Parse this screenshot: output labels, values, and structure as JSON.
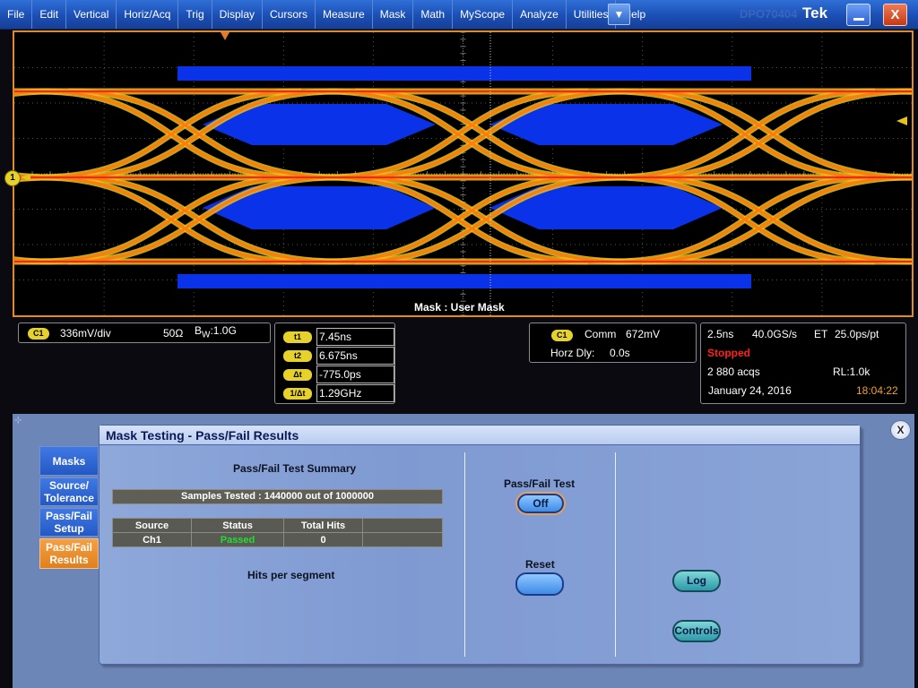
{
  "menubar": {
    "items": [
      "File",
      "Edit",
      "Vertical",
      "Horiz/Acq",
      "Trig",
      "Display",
      "Cursors",
      "Measure",
      "Mask",
      "Math",
      "MyScope",
      "Analyze",
      "Utilities",
      "Help"
    ],
    "dropdown_glyph": "▼",
    "ghost_text": "DPO70404",
    "logo": "Tek",
    "close_glyph": "X"
  },
  "display": {
    "mask_label": "Mask : User Mask",
    "channel_marker": "1"
  },
  "channel_readout": {
    "badge": "C1",
    "scale": "336mV/div",
    "impedance": "50Ω",
    "bandwidth_prefix": "B",
    "bandwidth_sub": "W",
    "bandwidth_value": ":1.0G"
  },
  "cursors": [
    {
      "badge": "t1",
      "value": "7.45ns"
    },
    {
      "badge": "t2",
      "value": "6.675ns"
    },
    {
      "badge": "Δt",
      "value": "-775.0ps"
    },
    {
      "badge": "1/Δt",
      "value": "1.29GHz"
    }
  ],
  "trigger_readout": {
    "badge": "C1",
    "mode": "Comm",
    "level": "672mV",
    "horz_dly_label": "Horz Dly:",
    "horz_dly_value": "0.0s"
  },
  "acq_readout": {
    "timebase": "2.5ns",
    "sample_rate": "40.0GS/s",
    "mode": "ET",
    "resolution": "25.0ps/pt",
    "status": "Stopped",
    "acqs": "2 880 acqs",
    "record_length": "RL:1.0k",
    "date": "January 24, 2016",
    "time": "18:04:22"
  },
  "panel": {
    "close_glyph": "X",
    "title": "Mask Testing - Pass/Fail Results",
    "tabs": [
      {
        "label": "Masks",
        "active": false
      },
      {
        "label": "Source/ Tolerance",
        "active": false
      },
      {
        "label": "Pass/Fail Setup",
        "active": false
      },
      {
        "label": "Pass/Fail Results",
        "active": true
      }
    ],
    "summary_title": "Pass/Fail Test Summary",
    "samples_tested": "Samples Tested :   1440000 out of 1000000",
    "table": {
      "headers": [
        "Source",
        "Status",
        "Total Hits",
        ""
      ],
      "rows": [
        [
          "Ch1",
          "Passed",
          "0",
          ""
        ]
      ]
    },
    "hits_per_segment": "Hits per segment",
    "passfail_test_label": "Pass/Fail Test",
    "passfail_test_value": "Off",
    "reset_label": "Reset",
    "log_button": "Log",
    "controls_button": "Controls"
  },
  "colors": {
    "accent_orange": "#e08a2a",
    "menu_blue": "#1b4fb5",
    "mask_blue": "#0a32e8",
    "trace_yellow": "#e8c21a",
    "trace_red": "#ee2a10",
    "status_red": "#ff2020",
    "status_passed": "#22dd33",
    "time_orange": "#f0a030"
  }
}
